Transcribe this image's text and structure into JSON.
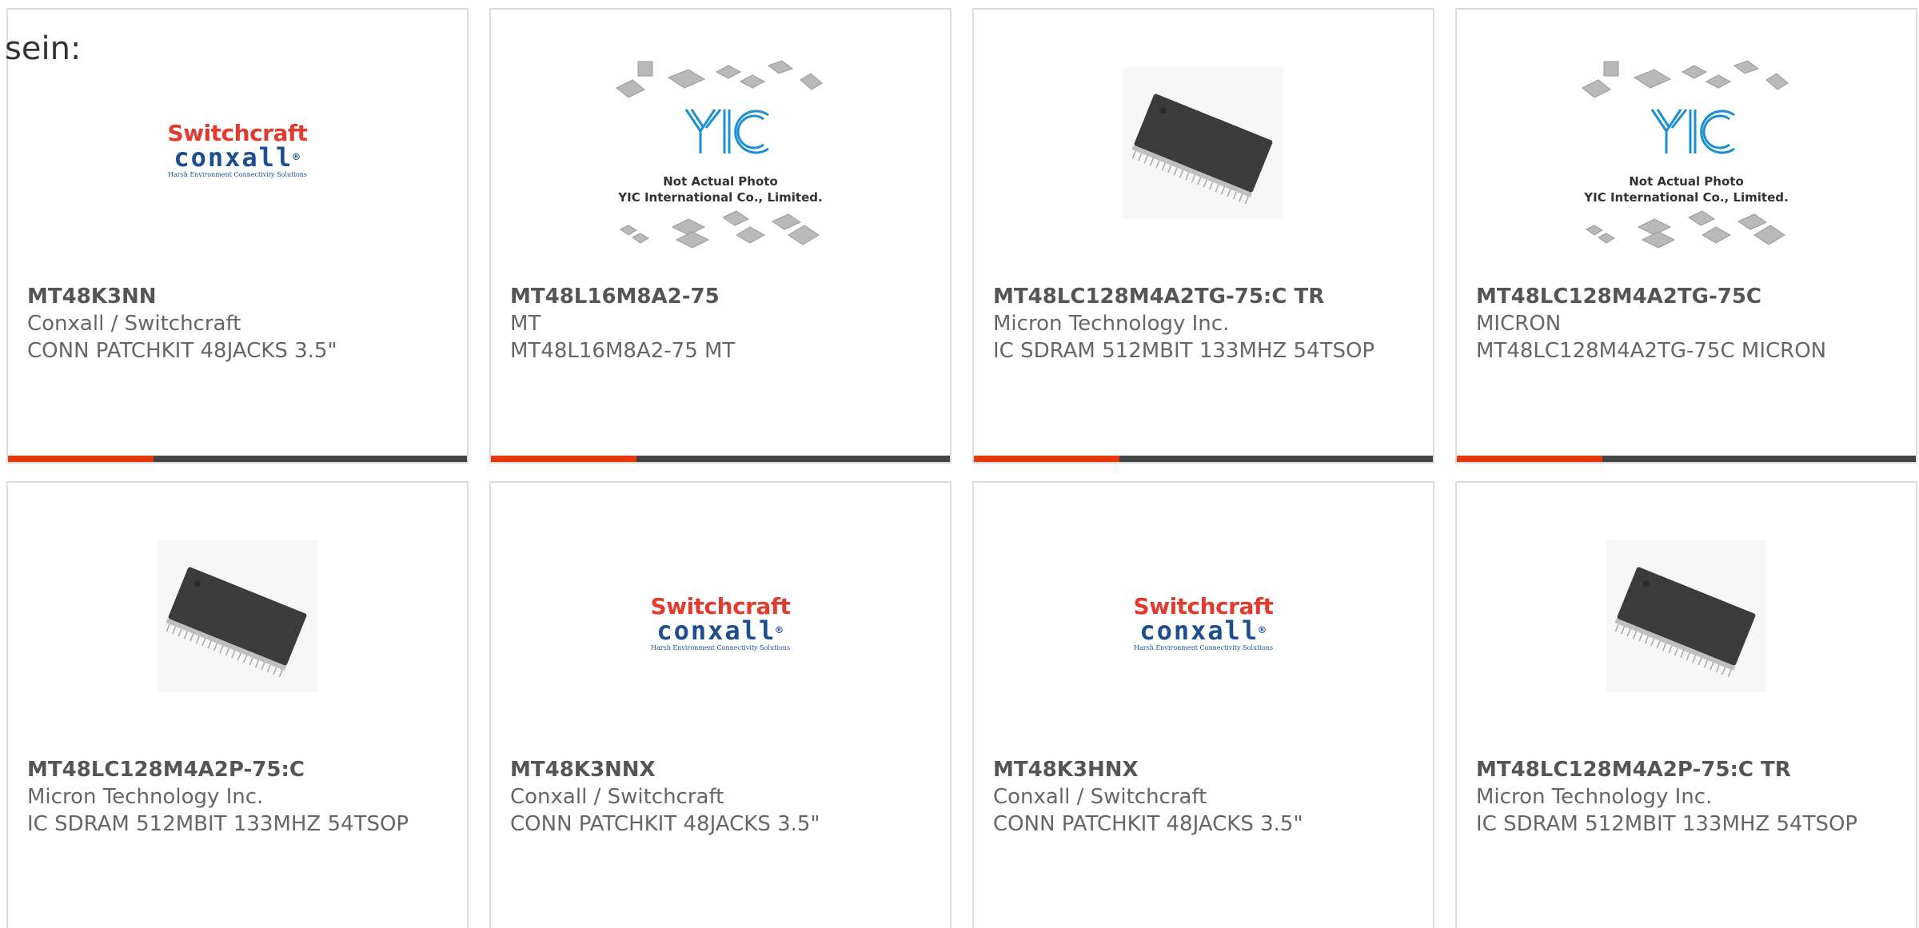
{
  "intro_text": "sein:",
  "colors": {
    "accent": "#e8380d",
    "bar": "#444444",
    "border": "#dddddd",
    "switchcraft_red": "#e23b2e",
    "conxall_blue": "#1d4e8f",
    "yic_blue": "#1a8fd1"
  },
  "logos": {
    "switchcraft": {
      "line1": "Switchcraft",
      "line2": "conxall",
      "tagline": "Harsh Environment Connectivity Solutions"
    },
    "yic": {
      "mark": "YIC",
      "note1": "Not Actual Photo",
      "note2": "YIC International Co., Limited."
    }
  },
  "products": [
    {
      "image": "switchcraft-logo",
      "part_number": "MT48K3NN",
      "manufacturer": "Conxall / Switchcraft",
      "description": "CONN PATCHKIT 48JACKS 3.5\""
    },
    {
      "image": "yic-placeholder",
      "part_number": "MT48L16M8A2-75",
      "manufacturer": "MT",
      "description": "MT48L16M8A2-75 MT"
    },
    {
      "image": "tsop-chip",
      "part_number": "MT48LC128M4A2TG-75:C TR",
      "manufacturer": "Micron Technology Inc.",
      "description": "IC SDRAM 512MBIT 133MHZ 54TSOP"
    },
    {
      "image": "yic-placeholder",
      "part_number": "MT48LC128M4A2TG-75C",
      "manufacturer": "MICRON",
      "description": "MT48LC128M4A2TG-75C MICRON"
    },
    {
      "image": "tsop-chip",
      "part_number": "MT48LC128M4A2P-75:C",
      "manufacturer": "Micron Technology Inc.",
      "description": "IC SDRAM 512MBIT 133MHZ 54TSOP"
    },
    {
      "image": "switchcraft-logo",
      "part_number": "MT48K3NNX",
      "manufacturer": "Conxall / Switchcraft",
      "description": "CONN PATCHKIT 48JACKS 3.5\""
    },
    {
      "image": "switchcraft-logo",
      "part_number": "MT48K3HNX",
      "manufacturer": "Conxall / Switchcraft",
      "description": "CONN PATCHKIT 48JACKS 3.5\""
    },
    {
      "image": "tsop-chip",
      "part_number": "MT48LC128M4A2P-75:C TR",
      "manufacturer": "Micron Technology Inc.",
      "description": "IC SDRAM 512MBIT 133MHZ 54TSOP"
    }
  ]
}
